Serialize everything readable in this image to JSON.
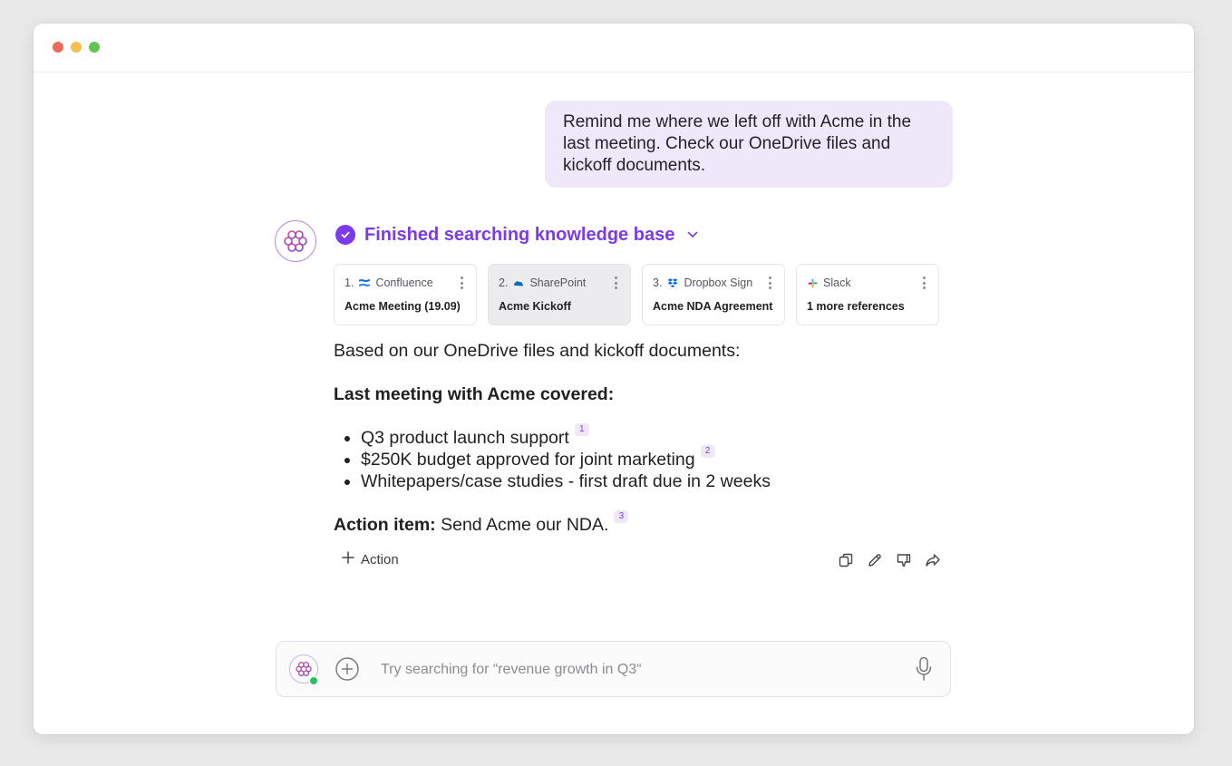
{
  "user_message": "Remind me where we left off with Acme in the last meeting. Check our OneDrive files and kickoff documents.",
  "status": {
    "text": "Finished searching knowledge base",
    "accent": "#7c3aed"
  },
  "references": [
    {
      "num": "1.",
      "source": "Confluence",
      "title": "Acme Meeting (19.09)",
      "icon": "confluence-icon"
    },
    {
      "num": "2.",
      "source": "SharePoint",
      "title": "Acme Kickoff",
      "icon": "sharepoint-icon"
    },
    {
      "num": "3.",
      "source": "Dropbox Sign",
      "title": "Acme NDA Agreement",
      "icon": "dropbox-sign-icon"
    },
    {
      "num": "",
      "source": "Slack",
      "title": "1 more references",
      "icon": "slack-icon"
    }
  ],
  "answer": {
    "intro": "Based on our OneDrive files and kickoff documents:",
    "heading": "Last meeting with Acme covered:",
    "bullets": [
      {
        "text": "Q3 product launch support",
        "cite": "1"
      },
      {
        "text": "$250K budget approved for joint marketing",
        "cite": "2"
      },
      {
        "text": "Whitepapers/case studies - first draft due in 2 weeks",
        "cite": ""
      }
    ],
    "action_label": "Action item:",
    "action_text": "Send Acme our NDA.",
    "action_cite": "3"
  },
  "add_action_label": "Action",
  "composer": {
    "placeholder": "Try searching for “revenue growth in Q3“"
  }
}
